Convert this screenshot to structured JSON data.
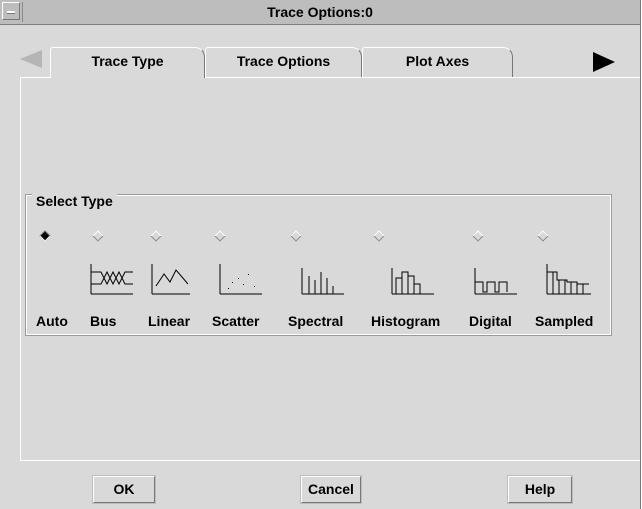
{
  "window": {
    "title": "Trace Options:0"
  },
  "tabs": [
    {
      "label": "Trace Type",
      "active": true
    },
    {
      "label": "Trace Options",
      "active": false
    },
    {
      "label": "Plot Axes",
      "active": false
    }
  ],
  "group": {
    "label": "Select Type"
  },
  "types": [
    {
      "label": "Auto",
      "selected": true,
      "icon": "none"
    },
    {
      "label": "Bus",
      "selected": false,
      "icon": "bus-icon"
    },
    {
      "label": "Linear",
      "selected": false,
      "icon": "linear-icon"
    },
    {
      "label": "Scatter",
      "selected": false,
      "icon": "scatter-icon"
    },
    {
      "label": "Spectral",
      "selected": false,
      "icon": "spectral-icon"
    },
    {
      "label": "Histogram",
      "selected": false,
      "icon": "histogram-icon"
    },
    {
      "label": "Digital",
      "selected": false,
      "icon": "digital-icon"
    },
    {
      "label": "Sampled",
      "selected": false,
      "icon": "sampled-icon"
    }
  ],
  "buttons": {
    "ok": "OK",
    "cancel": "Cancel",
    "help": "Help"
  },
  "colors": {
    "background": "#d9d9d9",
    "title_bar": "#bdbdbd"
  }
}
